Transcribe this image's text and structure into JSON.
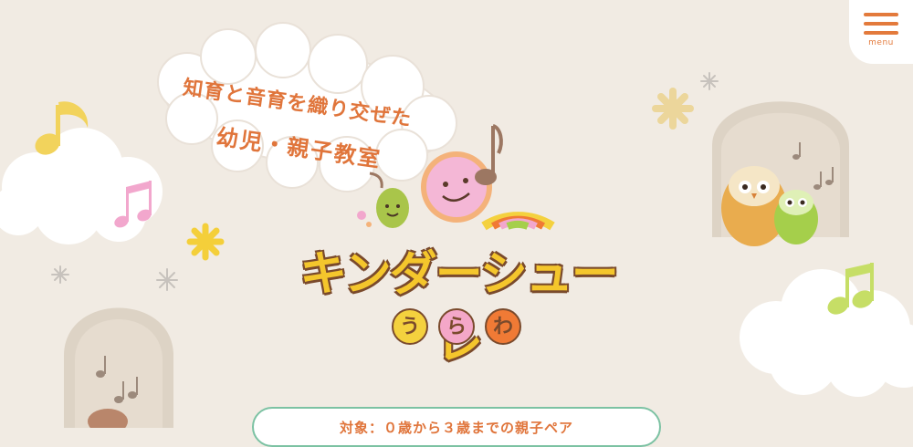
{
  "menu": {
    "label": "menu"
  },
  "hero": {
    "tagline_line1": "知育と音育を織り交ぜた",
    "tagline_line2": "幼児・親子教室"
  },
  "logo": {
    "title": "キンダーシューレ",
    "sub_chars": [
      "う",
      "ら",
      "わ"
    ]
  },
  "target": {
    "text": "対象：０歳から３歳までの親子ペア"
  },
  "colors": {
    "background": "#f1ebe3",
    "accent": "#e37a3c",
    "logo_yellow": "#f4c62c",
    "green_border": "#7cc2a3"
  }
}
